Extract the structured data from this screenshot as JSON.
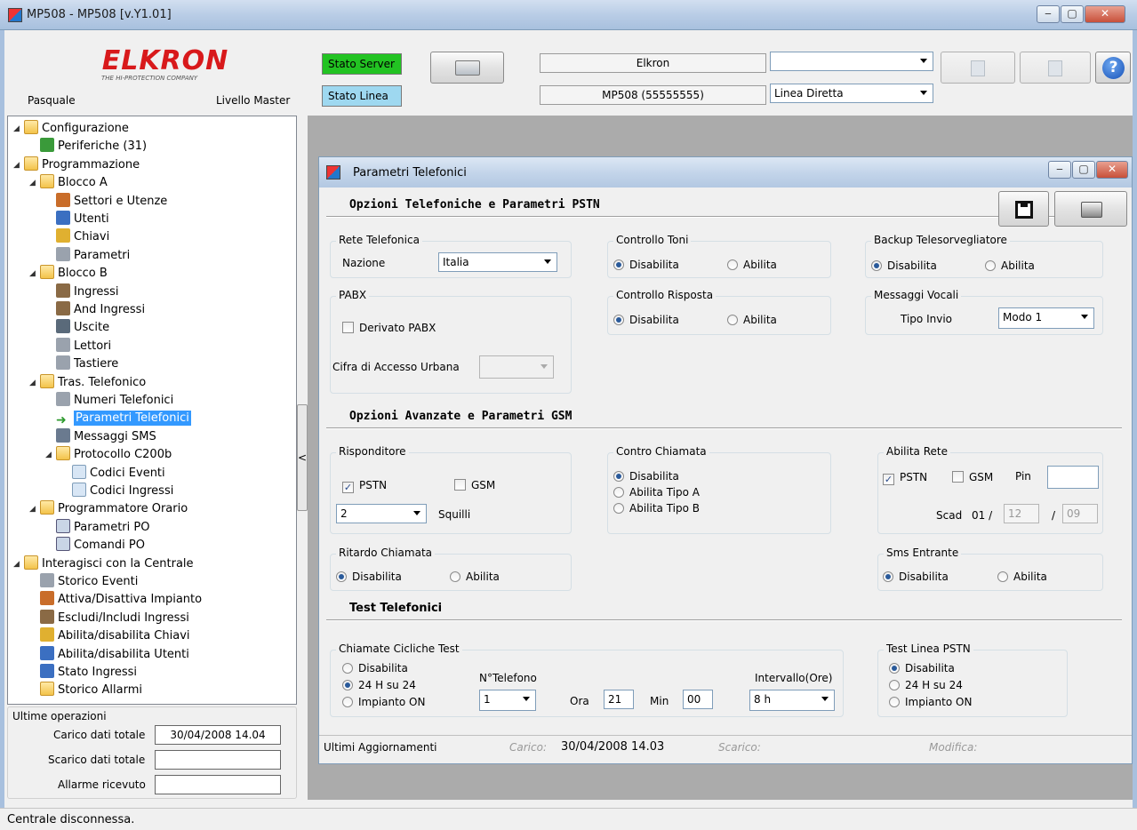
{
  "window": {
    "title": "MP508 - MP508 [v.Y1.01]"
  },
  "header": {
    "brand": "ELKRON",
    "tagline": "THE HI-PROTECTION COMPANY",
    "user": "Pasquale",
    "level": "Livello Master",
    "stato_server": "Stato Server",
    "stato_linea": "Stato Linea",
    "installer": "Elkron",
    "central": "MP508 (55555555)",
    "connection_combo": "",
    "line_type": "Linea Diretta",
    "colors": {
      "server_ok": "#22c322",
      "linea": "#9ed8f0"
    }
  },
  "tree": {
    "items": [
      {
        "label": "Configurazione"
      },
      {
        "label": "Periferiche (31)"
      },
      {
        "label": "Programmazione"
      },
      {
        "label": "Blocco A"
      },
      {
        "label": "Settori e Utenze"
      },
      {
        "label": "Utenti"
      },
      {
        "label": "Chiavi"
      },
      {
        "label": "Parametri"
      },
      {
        "label": "Blocco B"
      },
      {
        "label": "Ingressi"
      },
      {
        "label": "And Ingressi"
      },
      {
        "label": "Uscite"
      },
      {
        "label": "Lettori"
      },
      {
        "label": "Tastiere"
      },
      {
        "label": "Tras. Telefonico"
      },
      {
        "label": "Numeri Telefonici"
      },
      {
        "label": "Parametri Telefonici"
      },
      {
        "label": "Messaggi SMS"
      },
      {
        "label": "Protocollo C200b"
      },
      {
        "label": "Codici Eventi"
      },
      {
        "label": "Codici Ingressi"
      },
      {
        "label": "Programmatore Orario"
      },
      {
        "label": "Parametri PO"
      },
      {
        "label": "Comandi PO"
      },
      {
        "label": "Interagisci con la Centrale"
      },
      {
        "label": "Storico Eventi"
      },
      {
        "label": "Attiva/Disattiva Impianto"
      },
      {
        "label": "Escludi/Includi Ingressi"
      },
      {
        "label": "Abilita/disabilita Chiavi"
      },
      {
        "label": "Abilita/disabilita Utenti"
      },
      {
        "label": "Stato Ingressi"
      },
      {
        "label": "Storico Allarmi"
      }
    ]
  },
  "ops": {
    "title": "Ultime operazioni",
    "carico_label": "Carico dati totale",
    "carico_value": "30/04/2008 14.04",
    "scarico_label": "Scarico dati totale",
    "scarico_value": "",
    "allarme_label": "Allarme ricevuto",
    "allarme_value": ""
  },
  "splitter": {
    "label": "<"
  },
  "child": {
    "title": "Parametri Telefonici",
    "sect1": "Opzioni Telefoniche e Parametri PSTN",
    "rete": {
      "caption": "Rete Telefonica",
      "nazione_label": "Nazione",
      "nazione_value": "Italia"
    },
    "controllo_toni": {
      "caption": "Controllo Toni",
      "opt1": "Disabilita",
      "opt2": "Abilita"
    },
    "backup": {
      "caption": "Backup Telesorvegliatore",
      "opt1": "Disabilita",
      "opt2": "Abilita"
    },
    "pabx": {
      "caption": "PABX",
      "derivato": "Derivato PABX",
      "cifra_label": "Cifra di Accesso Urbana",
      "cifra_value": ""
    },
    "controllo_risposta": {
      "caption": "Controllo Risposta",
      "opt1": "Disabilita",
      "opt2": "Abilita"
    },
    "messaggi": {
      "caption": "Messaggi Vocali",
      "tipo_label": "Tipo Invio",
      "tipo_value": "Modo 1"
    },
    "sect2": "Opzioni Avanzate e Parametri GSM",
    "risponditore": {
      "caption": "Risponditore",
      "pstn": "PSTN",
      "gsm": "GSM",
      "squilli_value": "2",
      "squilli_label": "Squilli"
    },
    "contro": {
      "caption": "Contro Chiamata",
      "opt1": "Disabilita",
      "opt2": "Abilita Tipo A",
      "opt3": "Abilita Tipo B"
    },
    "abilita_rete": {
      "caption": "Abilita Rete",
      "pstn": "PSTN",
      "gsm": "GSM",
      "pin_label": "Pin",
      "pin_value": "",
      "scad_label": "Scad",
      "scad_day": "01 /",
      "scad_month": "12",
      "sep": "/",
      "scad_year": "09"
    },
    "ritardo": {
      "caption": "Ritardo Chiamata",
      "opt1": "Disabilita",
      "opt2": "Abilita"
    },
    "sms": {
      "caption": "Sms Entrante",
      "opt1": "Disabilita",
      "opt2": "Abilita"
    },
    "sect3": "Test Telefonici",
    "cicliche": {
      "caption": "Chiamate Cicliche Test",
      "opt1": "Disabilita",
      "opt2": "24 H su 24",
      "opt3": "Impianto ON",
      "ntel_label": "N°Telefono",
      "ntel_value": "1",
      "ora_label": "Ora",
      "ora_value": "21",
      "min_label": "Min",
      "min_value": "00",
      "intervallo_label": "Intervallo(Ore)",
      "intervallo_value": "8 h"
    },
    "test_pstn": {
      "caption": "Test Linea PSTN",
      "opt1": "Disabilita",
      "opt2": "24 H su 24",
      "opt3": "Impianto ON"
    },
    "footer": {
      "label": "Ultimi Aggiornamenti",
      "carico_label": "Carico:",
      "carico_value": "30/04/2008 14.03",
      "scarico_label": "Scarico:",
      "modifica_label": "Modifica:"
    }
  },
  "status": {
    "text": "Centrale disconnessa."
  }
}
